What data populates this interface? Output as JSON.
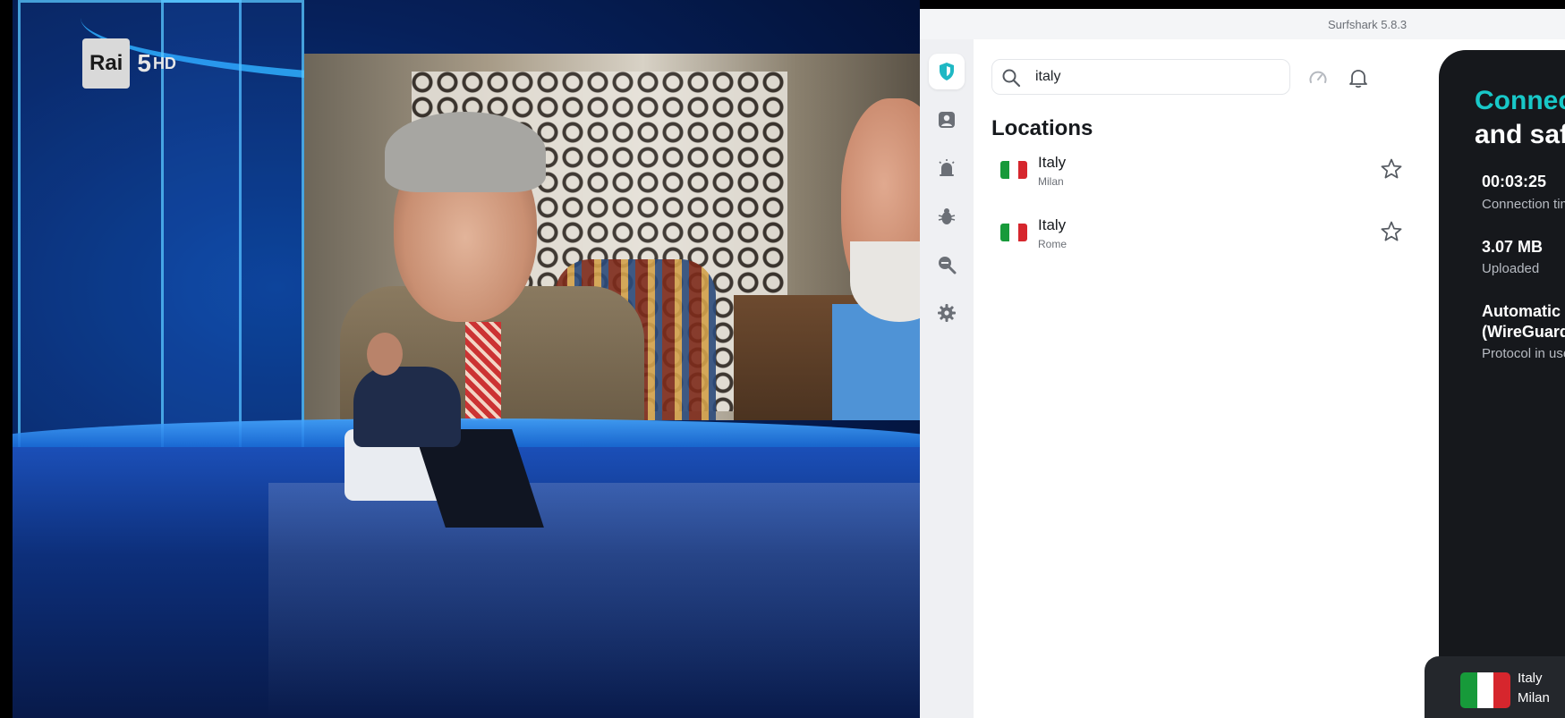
{
  "video": {
    "channel_logo": {
      "brand": "Rai",
      "number": "5",
      "suffix": "HD"
    }
  },
  "app": {
    "title": "Surfshark 5.8.3",
    "nav": {
      "items": [
        {
          "name": "vpn",
          "icon": "shield-icon",
          "active": true
        },
        {
          "name": "account",
          "icon": "person-icon",
          "active": false
        },
        {
          "name": "alert",
          "icon": "alarm-icon",
          "active": false
        },
        {
          "name": "antivirus",
          "icon": "bug-icon",
          "active": false
        },
        {
          "name": "search",
          "icon": "search-zoom-icon",
          "active": false
        },
        {
          "name": "settings",
          "icon": "gear-icon",
          "active": false
        }
      ]
    },
    "search": {
      "value": "italy",
      "placeholder": ""
    },
    "locations_title": "Locations",
    "locations": [
      {
        "country": "Italy",
        "city": "Milan"
      },
      {
        "country": "Italy",
        "city": "Rome"
      }
    ],
    "status": {
      "heading_line1": "Connected",
      "heading_line2": "and safe",
      "connection_time": "00:03:25",
      "connection_time_label": "Connection time",
      "uploaded": "3.07 MB",
      "uploaded_label": "Uploaded",
      "protocol_line1": "Automatic",
      "protocol_line2": "(WireGuard®)",
      "protocol_label": "Protocol in use"
    },
    "current_location": {
      "country": "Italy",
      "city": "Milan"
    },
    "colors": {
      "accent_teal": "#18c8c8",
      "flag_green": "#179a3a",
      "flag_white": "#ffffff",
      "flag_red": "#d6262d"
    }
  }
}
